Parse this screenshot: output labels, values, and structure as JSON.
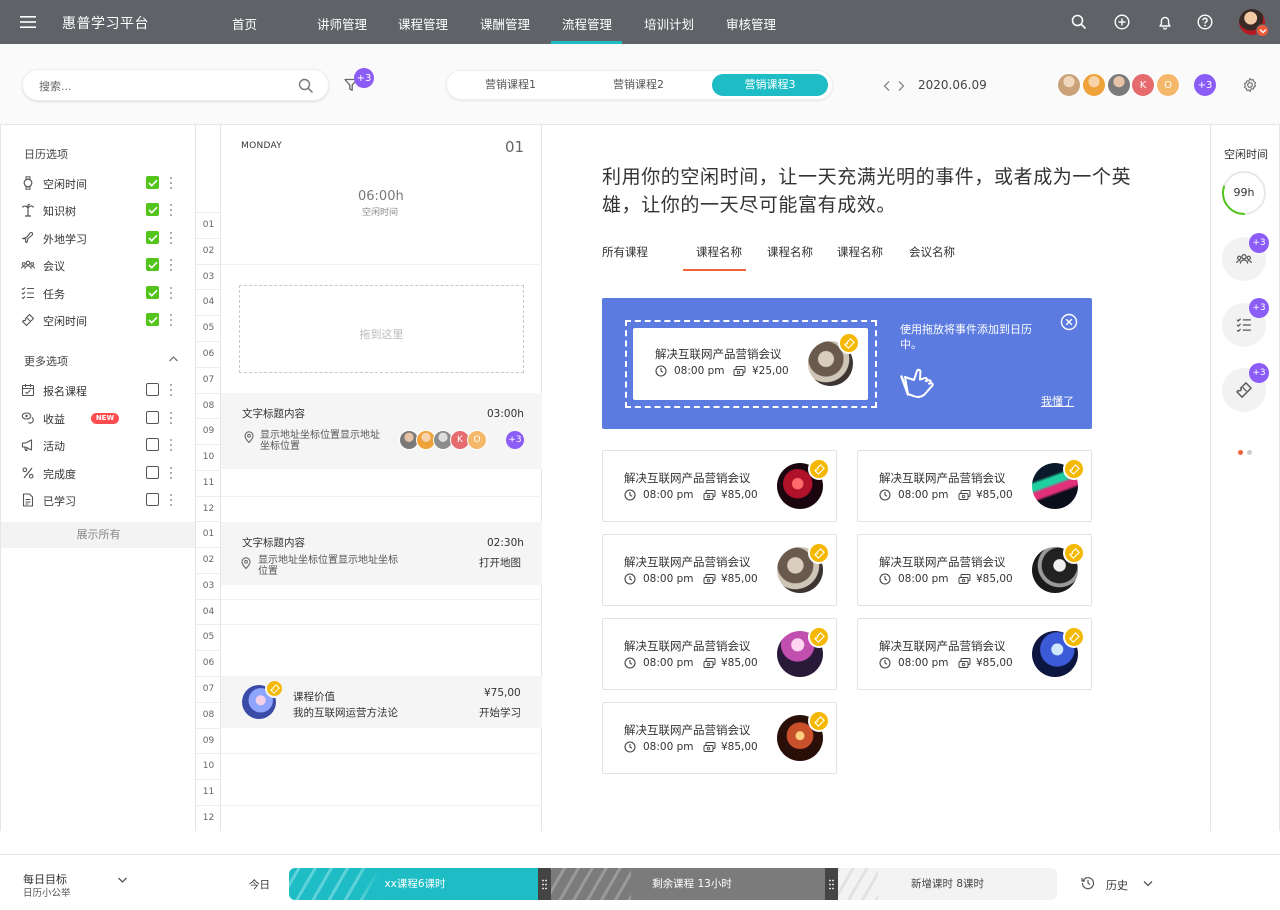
{
  "app": {
    "title": "惠普学习平台"
  },
  "nav": {
    "items": [
      "首页",
      "讲师管理",
      "课程管理",
      "课酬管理",
      "流程管理",
      "培训计划",
      "审核管理"
    ],
    "active": "流程管理"
  },
  "top_icons": [
    "search-icon",
    "plus-circle-icon",
    "bell-icon",
    "help-icon"
  ],
  "toolbar": {
    "search_placeholder": "搜索...",
    "filter_badge": "+3",
    "tabs": [
      "营销课程1",
      "营销课程2",
      "营销课程3"
    ],
    "active_tab": "营销课程3",
    "date": "2020.06.09",
    "avatars": [
      {
        "initial": "",
        "color": "#c9a27a"
      },
      {
        "initial": "",
        "color": "#f0a23a"
      },
      {
        "initial": "",
        "color": "#7a7a7a"
      },
      {
        "initial": "K",
        "color": "#e56b6f"
      },
      {
        "initial": "O",
        "color": "#f5b86a"
      }
    ],
    "avatar_more": "+3"
  },
  "sidebar": {
    "calendar_title": "日历选项",
    "calendar_items": [
      {
        "icon": "watch-icon",
        "label": "空闲时间",
        "checked": true
      },
      {
        "icon": "tree-icon",
        "label": "知识树",
        "checked": true
      },
      {
        "icon": "plane-icon",
        "label": "外地学习",
        "checked": true
      },
      {
        "icon": "people-icon",
        "label": "会议",
        "checked": true
      },
      {
        "icon": "list-check-icon",
        "label": "任务",
        "checked": true
      },
      {
        "icon": "ticket-icon",
        "label": "空闲时间",
        "checked": true
      }
    ],
    "more_title": "更多选项",
    "more_items": [
      {
        "icon": "calendar-icon",
        "label": "报名课程",
        "checked": false
      },
      {
        "icon": "coins-icon",
        "label": "收益",
        "checked": false,
        "badge": "NEW"
      },
      {
        "icon": "megaphone-icon",
        "label": "活动",
        "checked": false
      },
      {
        "icon": "percent-icon",
        "label": "完成度",
        "checked": false
      },
      {
        "icon": "document-icon",
        "label": "已学习",
        "checked": false
      }
    ],
    "show_all": "展示所有"
  },
  "calendar": {
    "day_name": "MONDAY",
    "day_num": "01",
    "free_time": "06:00h",
    "free_label": "空闲时间",
    "drop_text": "拖到这里",
    "hours": [
      "01",
      "02",
      "03",
      "04",
      "05",
      "06",
      "07",
      "08",
      "09",
      "10",
      "11",
      "12",
      "01",
      "02",
      "03",
      "04",
      "05",
      "06",
      "07",
      "08",
      "09",
      "10",
      "11",
      "12"
    ],
    "event1": {
      "title": "文字标题内容",
      "time": "03:00h",
      "address": "显示地址坐标位置显示地址坐标位置",
      "more": "+3"
    },
    "event2": {
      "title": "文字标题内容",
      "time": "02:30h",
      "address": "显示地址坐标位置显示地址坐标位置",
      "action": "打开地图"
    },
    "event3": {
      "title": "课程价值",
      "subtitle": "我的互联网运营方法论",
      "price": "¥75,00",
      "action": "开始学习"
    }
  },
  "main": {
    "headline": "利用你的空闲时间，让一天充满光明的事件，或者成为一个英雄，让你的一天尽可能富有成效。",
    "tabs": [
      "所有课程",
      "课程名称",
      "课程名称",
      "课程名称",
      "会议名称"
    ],
    "active_tab_index": 1,
    "promo": {
      "card_title": "解决互联网产品营销会议",
      "card_time": "08:00 pm",
      "card_price": "¥25,00",
      "text": "使用拖放将事件添加到日历中。",
      "got_it": "我懂了"
    },
    "cards": [
      {
        "title": "解决互联网产品营销会议",
        "time": "08:00 pm",
        "price": "¥85,00"
      },
      {
        "title": "解决互联网产品营销会议",
        "time": "08:00 pm",
        "price": "¥85,00"
      },
      {
        "title": "解决互联网产品营销会议",
        "time": "08:00 pm",
        "price": "¥85,00"
      },
      {
        "title": "解决互联网产品营销会议",
        "time": "08:00 pm",
        "price": "¥85,00"
      },
      {
        "title": "解决互联网产品营销会议",
        "time": "08:00 pm",
        "price": "¥85,00"
      },
      {
        "title": "解决互联网产品营销会议",
        "time": "08:00 pm",
        "price": "¥85,00"
      },
      {
        "title": "解决互联网产品营销会议",
        "time": "08:00 pm",
        "price": "¥85,00"
      }
    ]
  },
  "rightbar": {
    "title": "空闲时间",
    "hours": "99h",
    "ring_fraction": 0.3,
    "badges": [
      "+3",
      "+3",
      "+3"
    ]
  },
  "bottom": {
    "goal_title": "每日目标",
    "goal_sub": "日历小公举",
    "today": "今日",
    "seg1": "xx课程6课时",
    "seg2": "剩余课程 13小时",
    "seg3": "新增课时 8课时",
    "history": "历史"
  },
  "colors": {
    "accent": "#1ebcc4",
    "purple": "#8b5cf6",
    "green": "#52c41a",
    "promo": "#5b7be0",
    "orange": "#f0643c",
    "yellow": "#f5b800",
    "nav": "#5f6368"
  }
}
